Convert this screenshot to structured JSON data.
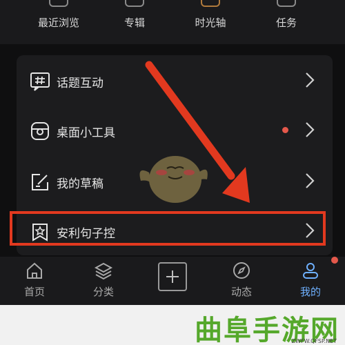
{
  "top_row": [
    {
      "label": "最近浏览",
      "icon": "clock-icon"
    },
    {
      "label": "专辑",
      "icon": "album-icon"
    },
    {
      "label": "时光轴",
      "icon": "timeline-icon"
    },
    {
      "label": "任务",
      "icon": "task-icon"
    }
  ],
  "menu": [
    {
      "label": "话题互动",
      "icon": "hashtag-icon"
    },
    {
      "label": "桌面小工具",
      "icon": "widget-icon",
      "has_badge": true
    },
    {
      "label": "我的草稿",
      "icon": "edit-icon"
    },
    {
      "label": "安利句子控",
      "icon": "bookmark-star-icon",
      "highlighted": true
    }
  ],
  "bottom_nav": [
    {
      "label": "首页",
      "icon": "home-icon"
    },
    {
      "label": "分类",
      "icon": "layers-icon"
    },
    {
      "label": "",
      "icon": "add-icon"
    },
    {
      "label": "动态",
      "icon": "compass-icon"
    },
    {
      "label": "我的",
      "icon": "user-icon",
      "active": true
    }
  ],
  "watermark": {
    "title": "曲阜手游网",
    "subtitle": "ZWFW.QFSP.NET"
  },
  "colors": {
    "accent": "#6fb1ff",
    "badge": "#e4584b",
    "annotation": "#e2391f",
    "watermark": "#55a82b"
  }
}
